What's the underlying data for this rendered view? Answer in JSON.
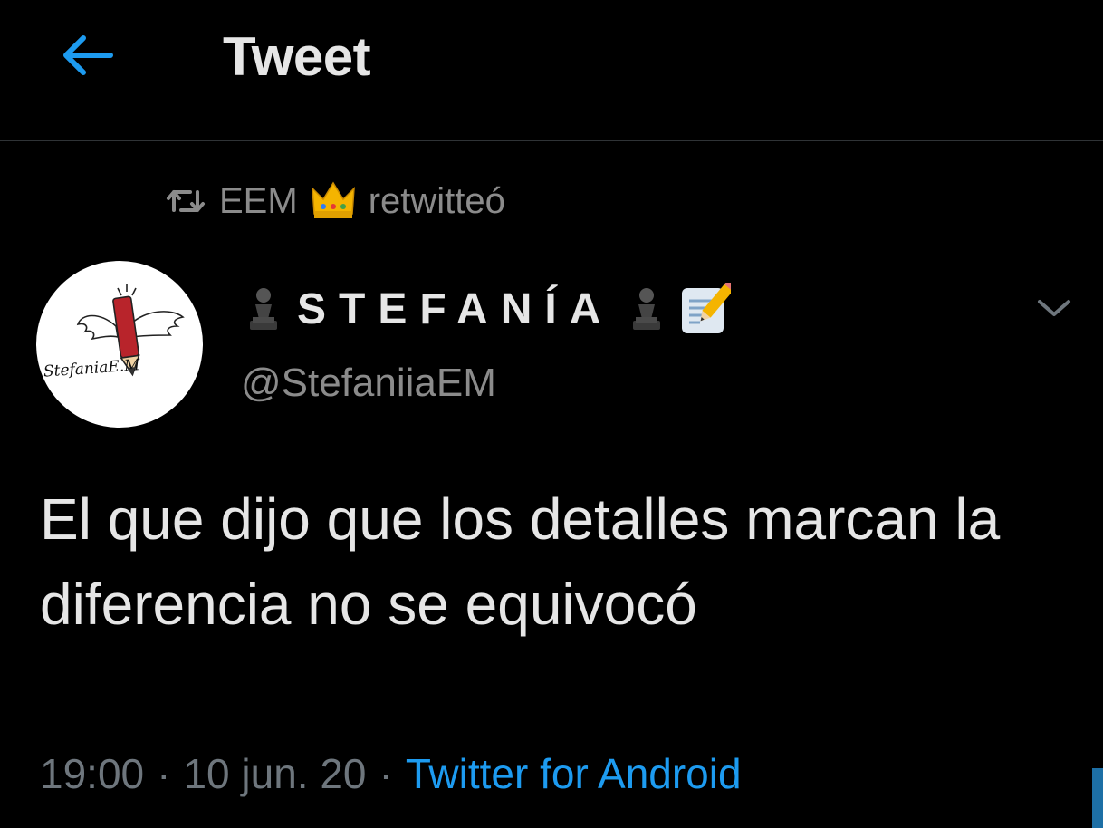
{
  "header": {
    "title": "Tweet",
    "back_icon": "arrow-left-icon",
    "accent_color": "#1d9bf0"
  },
  "retweet": {
    "icon": "retweet-icon",
    "user": "EEM",
    "badge_emoji": "crown-icon",
    "label": "retwitteó"
  },
  "author": {
    "avatar_text": "StefaniaE.M",
    "display_name": "STEFANÍA",
    "name_decor_left": "chess-pawn-icon",
    "name_decor_right": "chess-pawn-icon",
    "name_emoji": "memo-icon",
    "handle": "@StefaniiaEM",
    "menu_icon": "chevron-down-icon"
  },
  "tweet": {
    "text": "El que dijo que los detalles marcan la diferencia no se equivocó",
    "time": "19:00",
    "date": "10 jun. 20",
    "separator": "·",
    "source": "Twitter for Android"
  }
}
